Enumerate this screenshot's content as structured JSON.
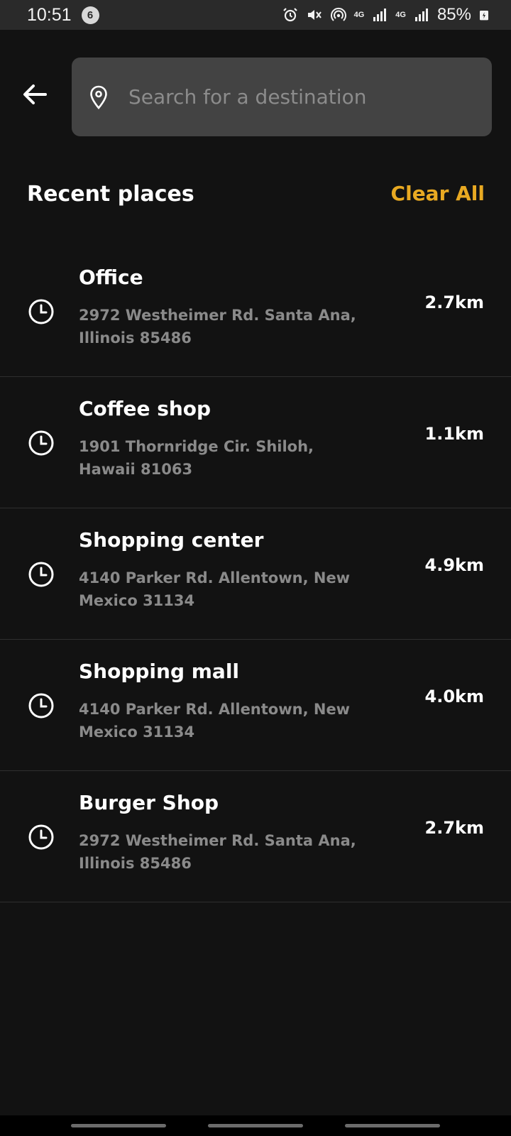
{
  "status_bar": {
    "time": "10:51",
    "notification_count": "6",
    "icons": [
      "alarm-icon",
      "mute-icon",
      "hotspot-icon",
      "signal-4g-icon",
      "signal-4g-icon",
      "battery-icon"
    ],
    "net_label_1": "4G",
    "net_label_2": "4G",
    "battery": "85%"
  },
  "search": {
    "placeholder": "Search for a destination",
    "value": ""
  },
  "recent": {
    "title": "Recent places",
    "clear_all_label": "Clear All"
  },
  "places": [
    {
      "name": "Office",
      "address": "2972 Westheimer Rd. Santa Ana, Illinois 85486",
      "distance": "2.7km"
    },
    {
      "name": "Coffee shop",
      "address": "1901 Thornridge Cir. Shiloh, Hawaii 81063",
      "distance": "1.1km"
    },
    {
      "name": "Shopping center",
      "address": "4140 Parker Rd. Allentown, New Mexico 31134",
      "distance": "4.9km"
    },
    {
      "name": "Shopping mall",
      "address": "4140 Parker Rd. Allentown, New Mexico 31134",
      "distance": "4.0km"
    },
    {
      "name": "Burger Shop",
      "address": "2972 Westheimer Rd. Santa Ana, Illinois 85486",
      "distance": "2.7km"
    }
  ],
  "colors": {
    "background": "#121212",
    "search_bg": "#434343",
    "accent": "#e8a922",
    "secondary_text": "#8a8a8a"
  }
}
